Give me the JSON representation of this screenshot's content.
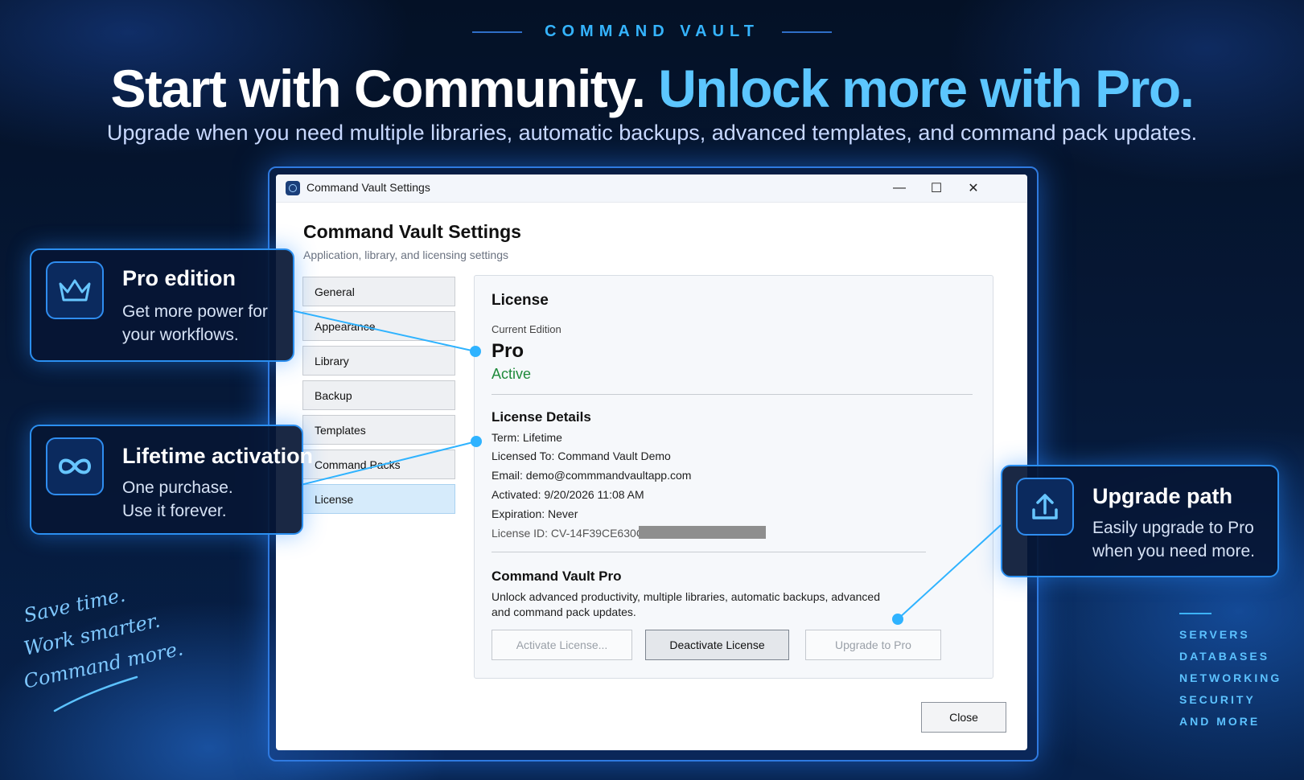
{
  "brand": "COMMAND VAULT",
  "headline": {
    "part1": "Start with Community.",
    "part2": "Unlock more with Pro."
  },
  "subheadline": "Upgrade when you need multiple libraries, automatic backups, advanced templates, and command pack updates.",
  "window": {
    "title": "Command Vault Settings",
    "controls": {
      "minimize": "—",
      "maximize": "☐",
      "close": "✕"
    },
    "heading": "Command Vault Settings",
    "subheading": "Application, library, and licensing settings",
    "nav": [
      {
        "label": "General"
      },
      {
        "label": "Appearance"
      },
      {
        "label": "Library"
      },
      {
        "label": "Backup"
      },
      {
        "label": "Templates"
      },
      {
        "label": "Command Packs"
      },
      {
        "label": "License"
      }
    ],
    "selected_nav": "License",
    "license": {
      "section_title": "License",
      "current_edition_label": "Current Edition",
      "edition": "Pro",
      "status": "Active",
      "details_title": "License Details",
      "term": "Term: Lifetime",
      "licensed_to": "Licensed To: Command Vault Demo",
      "email": "Email: demo@commmandvaultapp.com",
      "activated": "Activated: 9/20/2026 11:08 AM",
      "expiration": "Expiration: Never",
      "license_id": "License ID: CV-14F39CE630CA",
      "pro_title": "Command Vault Pro",
      "pro_desc": "Unlock advanced productivity, multiple libraries, automatic backups, advanced and command pack updates.",
      "buttons": {
        "activate": "Activate License...",
        "deactivate": "Deactivate License",
        "upgrade": "Upgrade to Pro"
      }
    },
    "close_button": "Close"
  },
  "callouts": {
    "pro": {
      "title": "Pro edition",
      "body": "Get more power for your workflows.",
      "icon": "crown-icon"
    },
    "lifetime": {
      "title": "Lifetime activation",
      "body_line1": "One purchase.",
      "body_line2": "Use it forever.",
      "icon": "infinity-icon"
    },
    "upgrade": {
      "title": "Upgrade path",
      "body": "Easily upgrade to Pro when you need more.",
      "icon": "upload-icon"
    }
  },
  "tagline": [
    "Save time.",
    "Work smarter.",
    "Command more."
  ],
  "categories": [
    "SERVERS",
    "DATABASES",
    "NETWORKING",
    "SECURITY",
    "AND MORE"
  ],
  "colors": {
    "accent": "#35b4ff",
    "active_status": "#1f8a3b",
    "selected_nav": "#d6ebfb",
    "callout_border": "#2b8ff0"
  }
}
